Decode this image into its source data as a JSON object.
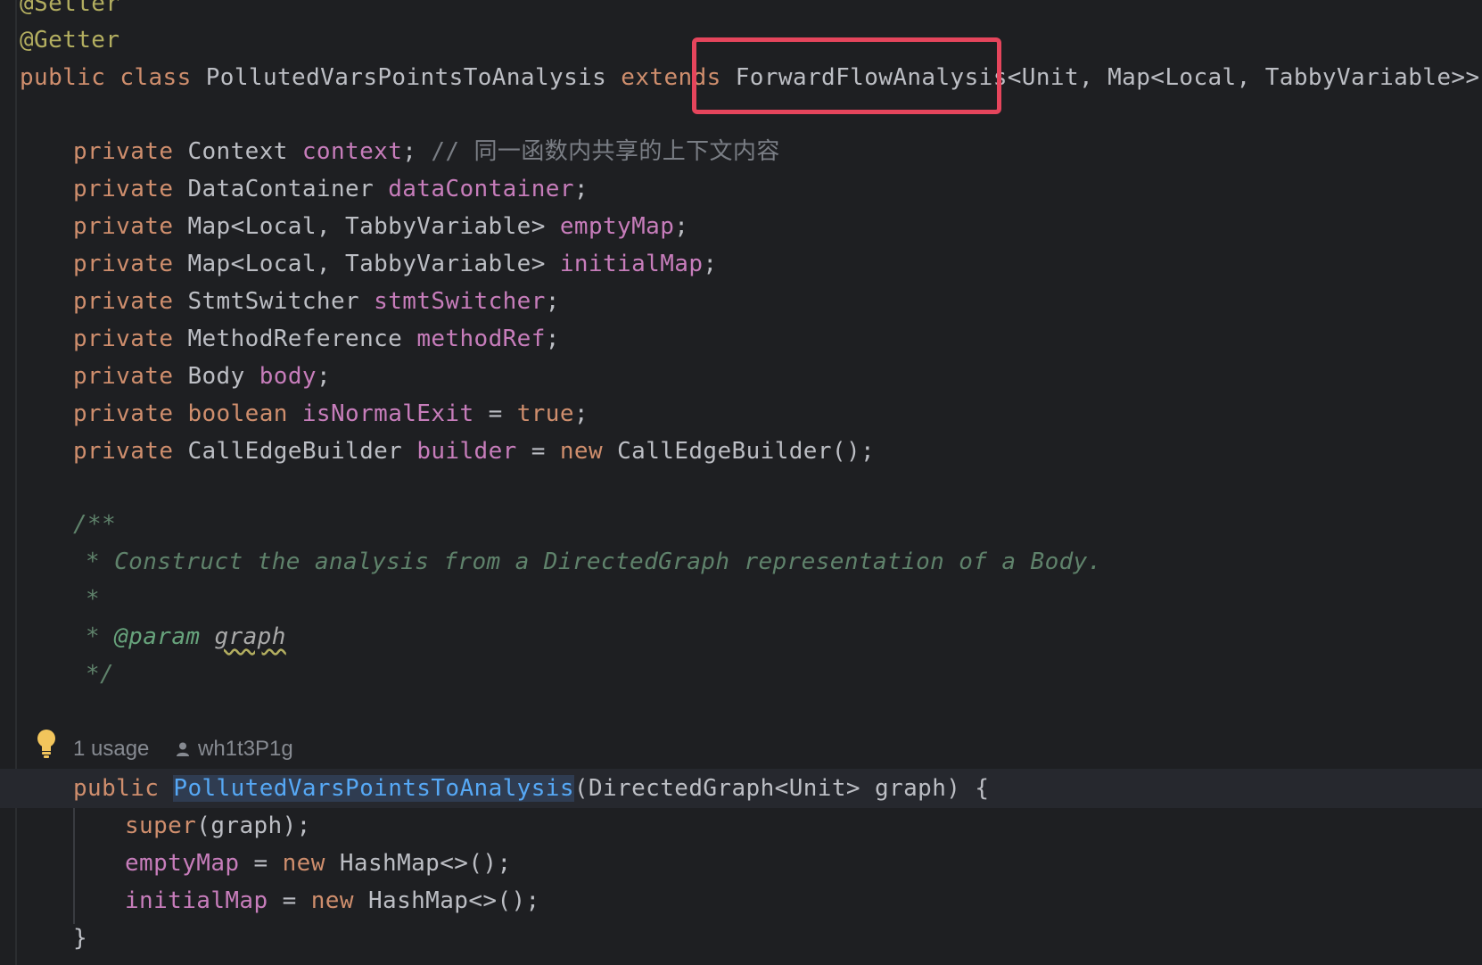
{
  "editor": {
    "code": {
      "setter": "@Setter",
      "getter": "@Getter",
      "class_public": "public",
      "class_kw": "class",
      "class_name": "PollutedVarsPointsToAnalysis",
      "extends_kw": "extends",
      "superclass": "ForwardFlowAnalysis<Unit, Map<Local, TabbyVariable>> {",
      "fields": [
        {
          "mod": "private",
          "type": "Context",
          "name": "context",
          "rest": ";",
          "comment": "// 同一函数内共享的上下文内容"
        },
        {
          "mod": "private",
          "type": "DataContainer",
          "name": "dataContainer",
          "rest": ";"
        },
        {
          "mod": "private",
          "type": "Map<Local, TabbyVariable>",
          "name": "emptyMap",
          "rest": ";"
        },
        {
          "mod": "private",
          "type": "Map<Local, TabbyVariable>",
          "name": "initialMap",
          "rest": ";"
        },
        {
          "mod": "private",
          "type": "StmtSwitcher",
          "name": "stmtSwitcher",
          "rest": ";"
        },
        {
          "mod": "private",
          "type": "MethodReference",
          "name": "methodRef",
          "rest": ";"
        },
        {
          "mod": "private",
          "type": "Body",
          "name": "body",
          "rest": ";"
        },
        {
          "mod": "private",
          "type_kw": "boolean",
          "name": "isNormalExit",
          "eq": "=",
          "value_kw": "true",
          "rest": ";"
        },
        {
          "mod": "private",
          "type": "CallEdgeBuilder",
          "name": "builder",
          "eq": "=",
          "new_kw": "new",
          "rest": "CallEdgeBuilder();"
        }
      ],
      "doc_open": "/**",
      "doc_line1": "* Construct the analysis from a DirectedGraph representation of a Body.",
      "doc_star": "*",
      "doc_param_star": "*",
      "doc_param_tag": "@param",
      "doc_param_name": "graph",
      "doc_close": "*/",
      "ctor_public": "public",
      "ctor_name": "PollutedVarsPointsToAnalysis",
      "ctor_params": "(DirectedGraph<Unit> graph) {",
      "super_kw": "super",
      "super_args": "(graph);",
      "empty_field": "emptyMap",
      "empty_assign": "=",
      "empty_new": "new",
      "empty_rest": "HashMap<>();",
      "init_field": "initialMap",
      "init_assign": "=",
      "init_new": "new",
      "init_rest": "HashMap<>();",
      "close_brace": "}"
    },
    "inlay": {
      "usages": "1 usage",
      "author": "wh1t3P1g"
    }
  },
  "colors": {
    "background": "#1e1f22",
    "keyword": "#cf8e6d",
    "field": "#c77dbb",
    "annotation": "#b3ae60",
    "doc_comment": "#5f826b",
    "method_declaration": "#56a8f5",
    "highlight_box": "#e5455c"
  },
  "icons": [
    "lightbulb-icon",
    "user-icon"
  ]
}
